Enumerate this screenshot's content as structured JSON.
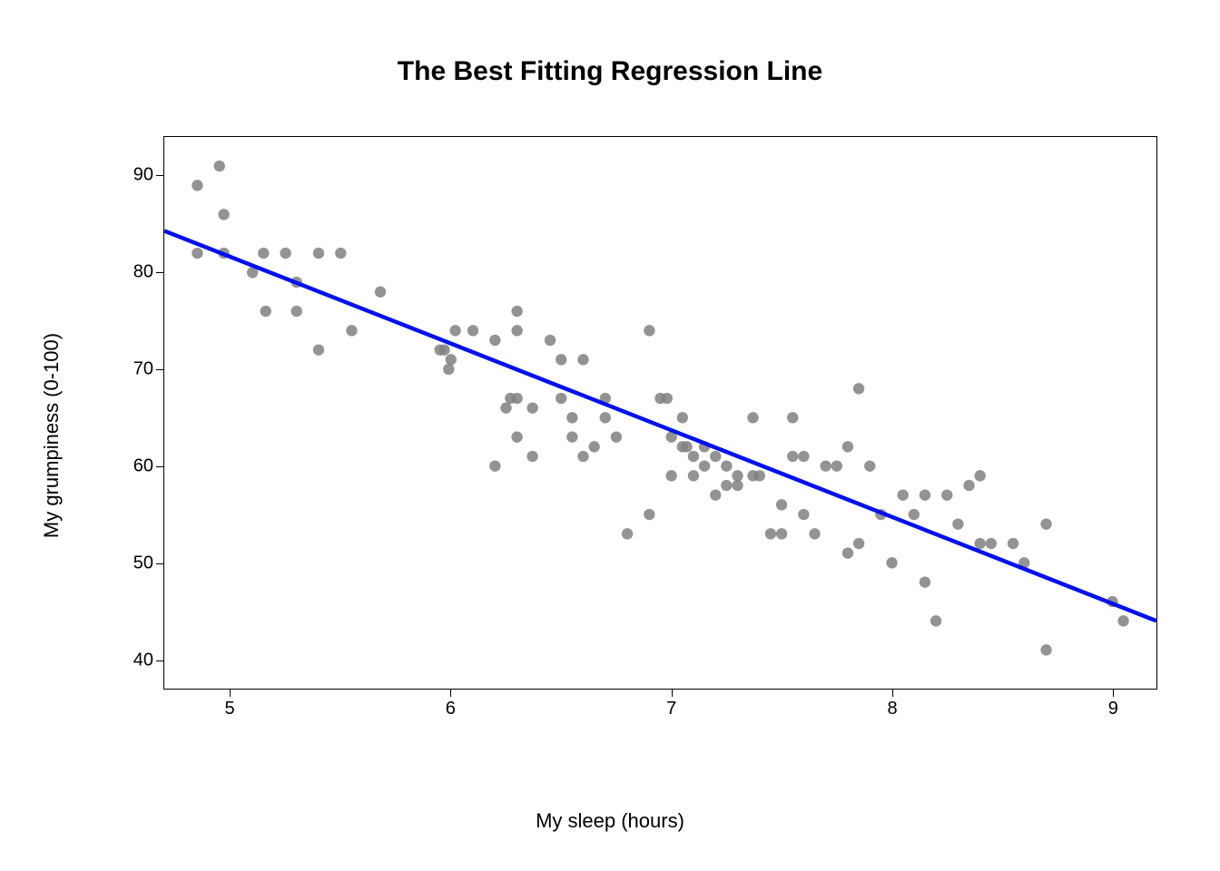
{
  "chart_data": {
    "type": "scatter",
    "title": "The Best Fitting Regression Line",
    "xlabel": "My sleep (hours)",
    "ylabel": "My grumpiness (0-100)",
    "xlim": [
      4.7,
      9.2
    ],
    "ylim": [
      37,
      94
    ],
    "x_ticks": [
      5,
      6,
      7,
      8,
      9
    ],
    "y_ticks": [
      40,
      50,
      60,
      70,
      80,
      90
    ],
    "regression_line": {
      "x1": 4.7,
      "y1": 84.3,
      "x2": 9.2,
      "y2": 44.0
    },
    "points": [
      {
        "x": 4.85,
        "y": 89
      },
      {
        "x": 4.95,
        "y": 91
      },
      {
        "x": 4.97,
        "y": 86
      },
      {
        "x": 4.85,
        "y": 82
      },
      {
        "x": 4.97,
        "y": 82
      },
      {
        "x": 5.1,
        "y": 80
      },
      {
        "x": 5.15,
        "y": 82
      },
      {
        "x": 5.25,
        "y": 82
      },
      {
        "x": 5.16,
        "y": 76
      },
      {
        "x": 5.3,
        "y": 79
      },
      {
        "x": 5.3,
        "y": 76
      },
      {
        "x": 5.4,
        "y": 82
      },
      {
        "x": 5.5,
        "y": 82
      },
      {
        "x": 5.4,
        "y": 72
      },
      {
        "x": 5.55,
        "y": 74
      },
      {
        "x": 5.68,
        "y": 78
      },
      {
        "x": 5.95,
        "y": 72
      },
      {
        "x": 5.97,
        "y": 72
      },
      {
        "x": 5.99,
        "y": 70
      },
      {
        "x": 6.0,
        "y": 71
      },
      {
        "x": 6.02,
        "y": 74
      },
      {
        "x": 6.1,
        "y": 74
      },
      {
        "x": 6.2,
        "y": 73
      },
      {
        "x": 6.3,
        "y": 74
      },
      {
        "x": 6.3,
        "y": 76
      },
      {
        "x": 6.2,
        "y": 60
      },
      {
        "x": 6.25,
        "y": 66
      },
      {
        "x": 6.27,
        "y": 67
      },
      {
        "x": 6.3,
        "y": 67
      },
      {
        "x": 6.3,
        "y": 63
      },
      {
        "x": 6.37,
        "y": 66
      },
      {
        "x": 6.37,
        "y": 61
      },
      {
        "x": 6.45,
        "y": 73
      },
      {
        "x": 6.5,
        "y": 67
      },
      {
        "x": 6.5,
        "y": 71
      },
      {
        "x": 6.55,
        "y": 63
      },
      {
        "x": 6.55,
        "y": 65
      },
      {
        "x": 6.6,
        "y": 71
      },
      {
        "x": 6.6,
        "y": 61
      },
      {
        "x": 6.65,
        "y": 62
      },
      {
        "x": 6.7,
        "y": 65
      },
      {
        "x": 6.7,
        "y": 67
      },
      {
        "x": 6.75,
        "y": 63
      },
      {
        "x": 6.9,
        "y": 55
      },
      {
        "x": 6.8,
        "y": 53
      },
      {
        "x": 6.95,
        "y": 67
      },
      {
        "x": 6.98,
        "y": 67
      },
      {
        "x": 6.9,
        "y": 74
      },
      {
        "x": 7.0,
        "y": 63
      },
      {
        "x": 7.0,
        "y": 59
      },
      {
        "x": 7.05,
        "y": 62
      },
      {
        "x": 7.05,
        "y": 65
      },
      {
        "x": 7.07,
        "y": 62
      },
      {
        "x": 7.1,
        "y": 61
      },
      {
        "x": 7.1,
        "y": 59
      },
      {
        "x": 7.15,
        "y": 60
      },
      {
        "x": 7.15,
        "y": 62
      },
      {
        "x": 7.2,
        "y": 57
      },
      {
        "x": 7.2,
        "y": 61
      },
      {
        "x": 7.25,
        "y": 58
      },
      {
        "x": 7.25,
        "y": 60
      },
      {
        "x": 7.3,
        "y": 58
      },
      {
        "x": 7.3,
        "y": 59
      },
      {
        "x": 7.37,
        "y": 59
      },
      {
        "x": 7.37,
        "y": 65
      },
      {
        "x": 7.4,
        "y": 59
      },
      {
        "x": 7.45,
        "y": 53
      },
      {
        "x": 7.5,
        "y": 56
      },
      {
        "x": 7.5,
        "y": 53
      },
      {
        "x": 7.55,
        "y": 65
      },
      {
        "x": 7.55,
        "y": 61
      },
      {
        "x": 7.6,
        "y": 55
      },
      {
        "x": 7.6,
        "y": 61
      },
      {
        "x": 7.65,
        "y": 53
      },
      {
        "x": 7.7,
        "y": 60
      },
      {
        "x": 7.75,
        "y": 60
      },
      {
        "x": 7.8,
        "y": 62
      },
      {
        "x": 7.8,
        "y": 51
      },
      {
        "x": 7.85,
        "y": 68
      },
      {
        "x": 7.9,
        "y": 60
      },
      {
        "x": 7.85,
        "y": 52
      },
      {
        "x": 7.95,
        "y": 55
      },
      {
        "x": 8.0,
        "y": 50
      },
      {
        "x": 8.05,
        "y": 57
      },
      {
        "x": 8.1,
        "y": 55
      },
      {
        "x": 8.15,
        "y": 57
      },
      {
        "x": 8.15,
        "y": 48
      },
      {
        "x": 8.2,
        "y": 44
      },
      {
        "x": 8.25,
        "y": 57
      },
      {
        "x": 8.3,
        "y": 54
      },
      {
        "x": 8.35,
        "y": 58
      },
      {
        "x": 8.4,
        "y": 59
      },
      {
        "x": 8.4,
        "y": 52
      },
      {
        "x": 8.45,
        "y": 52
      },
      {
        "x": 8.55,
        "y": 52
      },
      {
        "x": 8.6,
        "y": 50
      },
      {
        "x": 8.7,
        "y": 54
      },
      {
        "x": 8.7,
        "y": 41
      },
      {
        "x": 9.0,
        "y": 46
      },
      {
        "x": 9.05,
        "y": 44
      }
    ]
  }
}
